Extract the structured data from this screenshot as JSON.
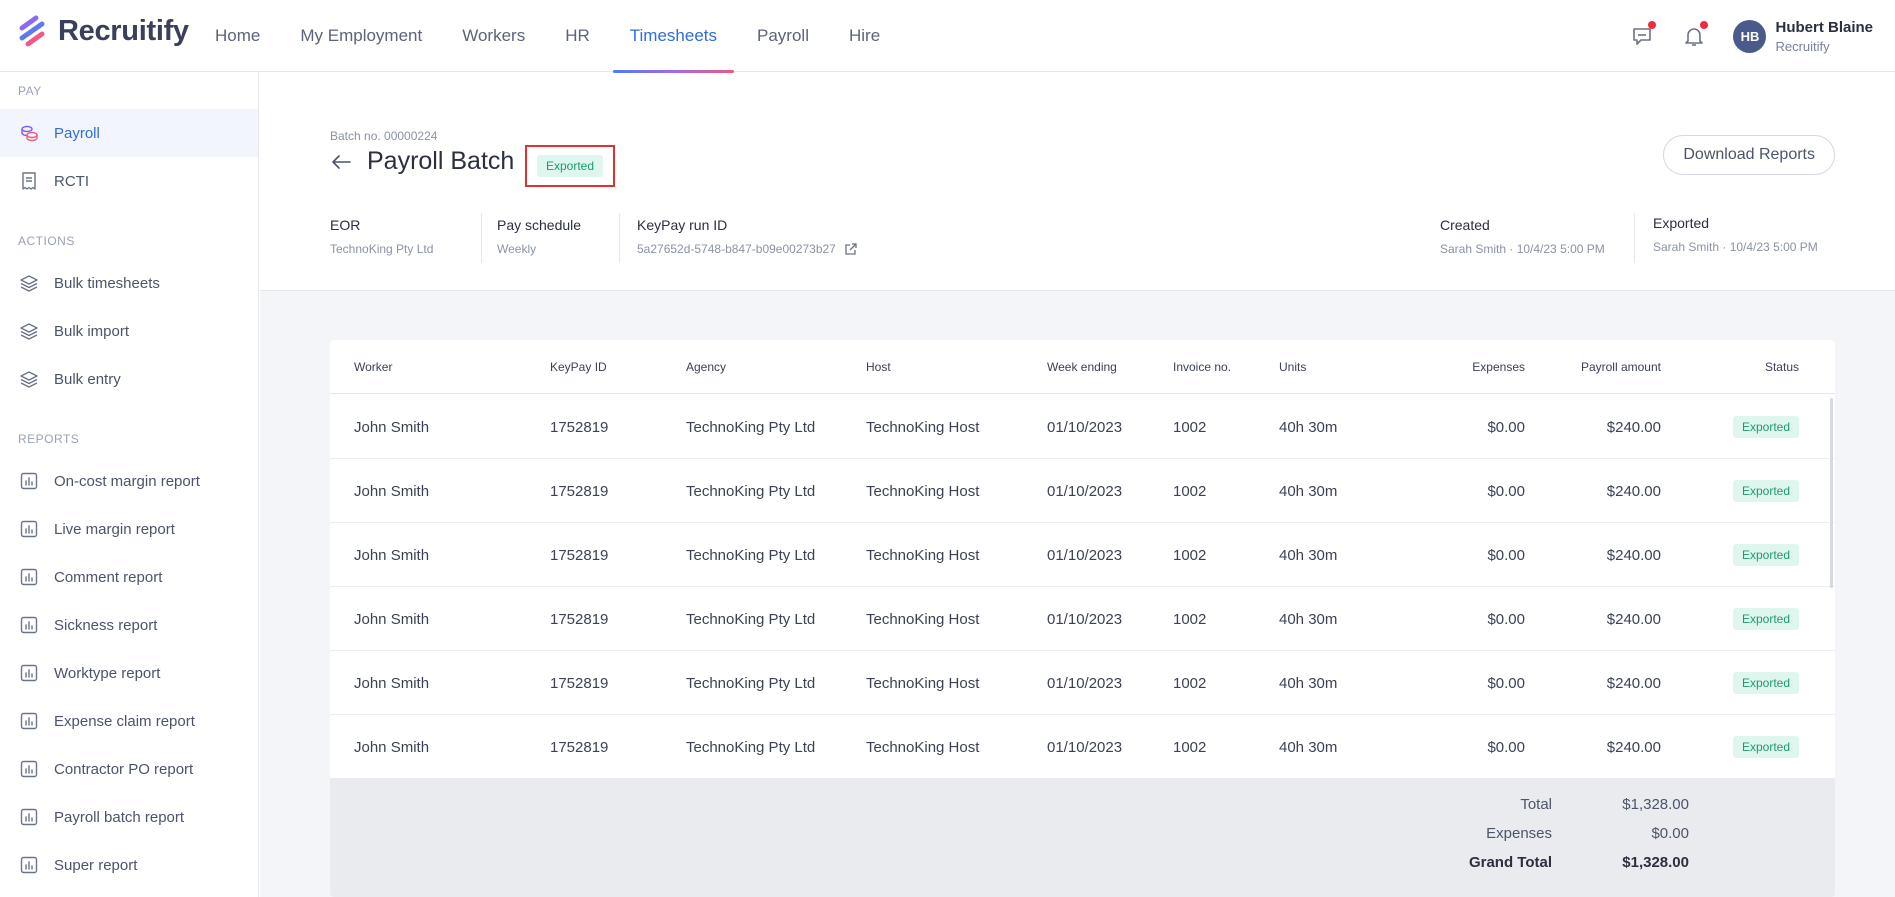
{
  "app": {
    "name": "Recruitify"
  },
  "nav": [
    {
      "label": "Home"
    },
    {
      "label": "My Employment"
    },
    {
      "label": "Workers"
    },
    {
      "label": "HR"
    },
    {
      "label": "Timesheets",
      "active": true
    },
    {
      "label": "Payroll"
    },
    {
      "label": "Hire"
    }
  ],
  "user": {
    "initials": "HB",
    "name": "Hubert Blaine",
    "org": "Recruitify"
  },
  "sidebar": {
    "pay_heading": "PAY",
    "pay_items": [
      {
        "label": "Payroll",
        "icon": "coins-icon",
        "active": true
      },
      {
        "label": "RCTI",
        "icon": "receipt-icon"
      }
    ],
    "actions_heading": "ACTIONS",
    "action_items": [
      {
        "label": "Bulk timesheets"
      },
      {
        "label": "Bulk import"
      },
      {
        "label": "Bulk entry"
      }
    ],
    "reports_heading": "REPORTS",
    "report_items": [
      {
        "label": "On-cost margin report"
      },
      {
        "label": "Live margin report"
      },
      {
        "label": "Comment report"
      },
      {
        "label": "Sickness report"
      },
      {
        "label": "Worktype report"
      },
      {
        "label": "Expense claim report"
      },
      {
        "label": "Contractor PO report"
      },
      {
        "label": "Payroll batch report"
      },
      {
        "label": "Super report"
      }
    ]
  },
  "batch": {
    "batch_no": "Batch no. 00000224",
    "title": "Payroll Batch",
    "status": "Exported",
    "download_label": "Download Reports",
    "eor_label": "EOR",
    "eor_value": "TechnoKing Pty Ltd",
    "schedule_label": "Pay schedule",
    "schedule_value": "Weekly",
    "keypay_label": "KeyPay run ID",
    "keypay_value": "5a27652d-5748-b847-b09e00273b27",
    "created_label": "Created",
    "created_value": "Sarah Smith · 10/4/23 5:00 PM",
    "exported_label": "Exported",
    "exported_value": "Sarah Smith · 10/4/23 5:00 PM"
  },
  "table": {
    "headers": [
      "Worker",
      "KeyPay ID",
      "Agency",
      "Host",
      "Week ending",
      "Invoice no.",
      "Units",
      "Expenses",
      "Payroll amount",
      "Status"
    ],
    "rows": [
      {
        "worker": "John Smith",
        "keypay_id": "1752819",
        "agency": "TechnoKing Pty Ltd",
        "host": "TechnoKing Host",
        "week_ending": "01/10/2023",
        "invoice": "1002",
        "units": "40h 30m",
        "expenses": "$0.00",
        "amount": "$240.00",
        "status": "Exported"
      },
      {
        "worker": "John Smith",
        "keypay_id": "1752819",
        "agency": "TechnoKing Pty Ltd",
        "host": "TechnoKing Host",
        "week_ending": "01/10/2023",
        "invoice": "1002",
        "units": "40h 30m",
        "expenses": "$0.00",
        "amount": "$240.00",
        "status": "Exported"
      },
      {
        "worker": "John Smith",
        "keypay_id": "1752819",
        "agency": "TechnoKing Pty Ltd",
        "host": "TechnoKing Host",
        "week_ending": "01/10/2023",
        "invoice": "1002",
        "units": "40h 30m",
        "expenses": "$0.00",
        "amount": "$240.00",
        "status": "Exported"
      },
      {
        "worker": "John Smith",
        "keypay_id": "1752819",
        "agency": "TechnoKing Pty Ltd",
        "host": "TechnoKing Host",
        "week_ending": "01/10/2023",
        "invoice": "1002",
        "units": "40h 30m",
        "expenses": "$0.00",
        "amount": "$240.00",
        "status": "Exported"
      },
      {
        "worker": "John Smith",
        "keypay_id": "1752819",
        "agency": "TechnoKing Pty Ltd",
        "host": "TechnoKing Host",
        "week_ending": "01/10/2023",
        "invoice": "1002",
        "units": "40h 30m",
        "expenses": "$0.00",
        "amount": "$240.00",
        "status": "Exported"
      },
      {
        "worker": "John Smith",
        "keypay_id": "1752819",
        "agency": "TechnoKing Pty Ltd",
        "host": "TechnoKing Host",
        "week_ending": "01/10/2023",
        "invoice": "1002",
        "units": "40h 30m",
        "expenses": "$0.00",
        "amount": "$240.00",
        "status": "Exported"
      }
    ],
    "totals": {
      "total_label": "Total",
      "total_value": "$1,328.00",
      "expenses_label": "Expenses",
      "expenses_value": "$0.00",
      "grand_label": "Grand Total",
      "grand_value": "$1,328.00"
    }
  },
  "colors": {
    "accent": "#2f6ed6",
    "badge_bg": "#dff6ee",
    "badge_text": "#1f9a6f",
    "highlight_box": "#e03131"
  }
}
